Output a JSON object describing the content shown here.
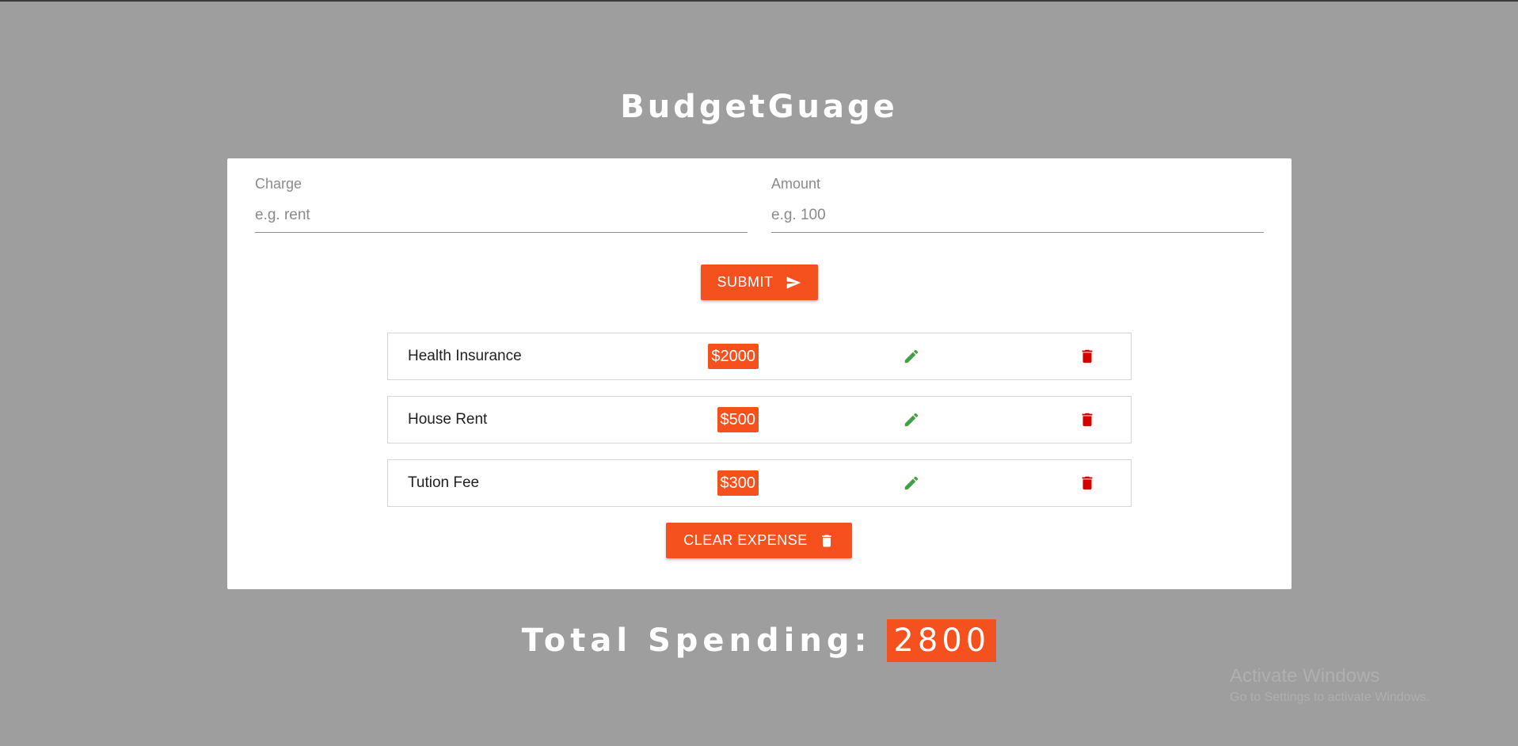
{
  "app": {
    "title": "BudgetGuage"
  },
  "form": {
    "charge": {
      "label": "Charge",
      "placeholder": "e.g. rent",
      "value": ""
    },
    "amount": {
      "label": "Amount",
      "placeholder": "e.g. 100",
      "value": ""
    },
    "submit_label": "SUBMIT",
    "submit_icon": "send-icon"
  },
  "expenses": [
    {
      "name": "Health Insurance",
      "amount": "$2000"
    },
    {
      "name": "House Rent",
      "amount": "$500"
    },
    {
      "name": "Tution Fee",
      "amount": "$300"
    }
  ],
  "actions": {
    "edit_icon": "pencil-icon",
    "delete_icon": "trash-icon"
  },
  "clear_label": "CLEAR EXPENSE",
  "total": {
    "label": "Total Spending:",
    "value": "2800"
  },
  "watermark": {
    "title": "Activate Windows",
    "subtitle": "Go to Settings to activate Windows."
  },
  "colors": {
    "background": "#9e9e9e",
    "accent": "#f4511e",
    "edit": "#43a047",
    "delete": "#d50000"
  }
}
